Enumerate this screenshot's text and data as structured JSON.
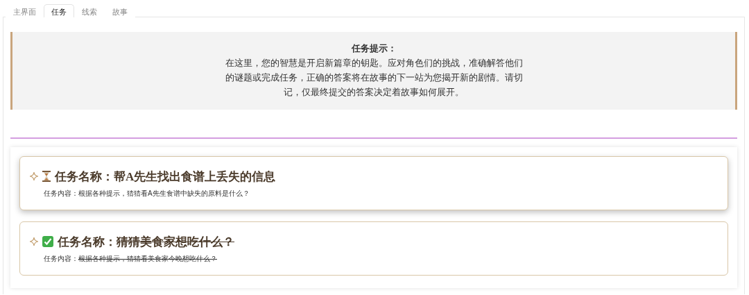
{
  "tabs": [
    {
      "label": "主界面",
      "selected": false
    },
    {
      "label": "任务",
      "selected": true
    },
    {
      "label": "线索",
      "selected": false
    },
    {
      "label": "故事",
      "selected": false
    }
  ],
  "hint": {
    "title": "任务提示：",
    "text": "在这里，您的智慧是开启新篇章的钥匙。应对角色们的挑战，准确解答他们的谜题或完成任务，正确的答案将在故事的下一站为您揭开新的剧情。请切记，仅最终提交的答案决定着故事如何展开。"
  },
  "tasks": [
    {
      "name_label": "任务名称：",
      "name": "帮A先生找出食谱上丢失的信息",
      "content_label": "任务内容：",
      "content": "根据各种提示，猜猜看A先生食谱中缺失的原料是什么？",
      "completed": false
    },
    {
      "name_label": "任务名称：",
      "name": "猜猜美食家想吃什么？",
      "content_label": "任务内容：",
      "content": "根据各种提示，猜猜看美食家今晚想吃什么？",
      "completed": true
    }
  ]
}
